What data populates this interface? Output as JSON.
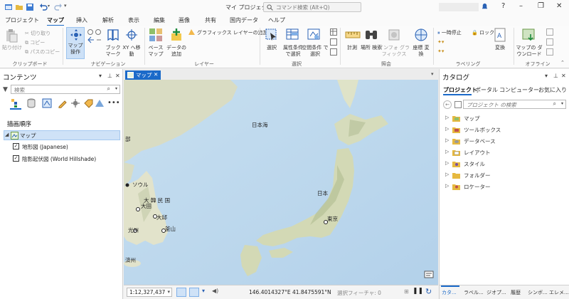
{
  "window": {
    "title": "マイ プロジェクト",
    "search_placeholder": "コマンド検索 (Alt+Q)"
  },
  "ribbon_tabs": [
    "プロジェクト",
    "マップ",
    "挿入",
    "解析",
    "表示",
    "編集",
    "画像",
    "共有",
    "国内データ",
    "ヘルプ"
  ],
  "clipboard": {
    "paste": "貼り付け",
    "cut": "切り取り",
    "copy": "コピー",
    "copy_path": "パスのコピー",
    "label": "クリップボード"
  },
  "navigation": {
    "explore": "マップ操作",
    "bookmarks": "ブック マーク",
    "go_to_xy": "XY へ移動",
    "label": "ナビゲーション"
  },
  "layer": {
    "basemap": "ベース マップ",
    "add_data": "データの 追加",
    "add_graphics_layer": "グラフィックス レイヤーの追加",
    "label": "レイヤー"
  },
  "selection": {
    "select": "選択",
    "select_by_attributes": "属性条件 で選択",
    "select_by_location": "空間条件 で選択",
    "label": "選択"
  },
  "inquiry": {
    "measure": "計測",
    "locate": "場所 検索",
    "infographics": "インフォ グラフィックス",
    "convert": "座標 変換",
    "label": "照会"
  },
  "labeling": {
    "pause": "一時停止",
    "lock": "ロック",
    "convert": "変換",
    "label": "ラベリング"
  },
  "offline": {
    "download_map": "マップの ダウンロード",
    "label": "オフライン"
  },
  "contents": {
    "title": "コンテンツ",
    "search_placeholder": "検索",
    "drawing_order": "描画順序",
    "map_item": "マップ",
    "layers": [
      {
        "name": "地形図 (Japanese)",
        "checked": true
      },
      {
        "name": "陰影起伏図 (World Hillshade)",
        "checked": true
      }
    ]
  },
  "map_view": {
    "tab_label": "マップ",
    "scale": "1:12,327,437",
    "coordinates": "146.4014327°E 41.8475591°N",
    "selected_features": "選択フィーチャ: 0",
    "labels": {
      "sea_of_japan": "日本海",
      "japan": "日本",
      "tokyo": "東京",
      "seoul": "ソウル",
      "daejeon": "大田",
      "korea": "大 韓 民 国",
      "daegu": "大邱",
      "gwangju": "光州",
      "busan": "釜山",
      "jeju": "済州",
      "north_edge": "部"
    }
  },
  "catalog": {
    "title": "カタログ",
    "tabs": [
      "プロジェクト",
      "ポータル",
      "コンピューター",
      "お気に入り"
    ],
    "search_placeholder": "プロジェクト の検索",
    "items": [
      "マップ",
      "ツールボックス",
      "データベース",
      "レイアウト",
      "スタイル",
      "フォルダー",
      "ロケーター"
    ],
    "bottom_tabs": [
      "カタ...",
      "ラベル...",
      "ジオプ...",
      "履歴",
      "シンボ...",
      "エレメ..."
    ]
  }
}
